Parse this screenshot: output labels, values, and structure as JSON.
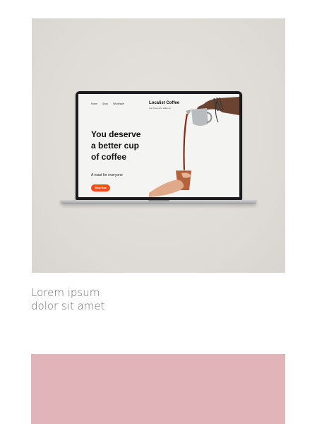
{
  "card": {
    "caption_line1": "Lorem ipsum",
    "caption_line2": "dolor sit amet",
    "background_color": "#dedad5"
  },
  "mockup_site": {
    "nav": [
      "Home",
      "Shop",
      "Wholesale"
    ],
    "brand": "Localist Coffee",
    "tagline": "For those who wake up",
    "headline": [
      "You deserve",
      "a better cup",
      "of coffee"
    ],
    "subtext": "A roast for everyone",
    "cta_label": "Shop Now",
    "accent_color": "#ff4a1c"
  },
  "second_card": {
    "color": "#e0b4b9"
  }
}
